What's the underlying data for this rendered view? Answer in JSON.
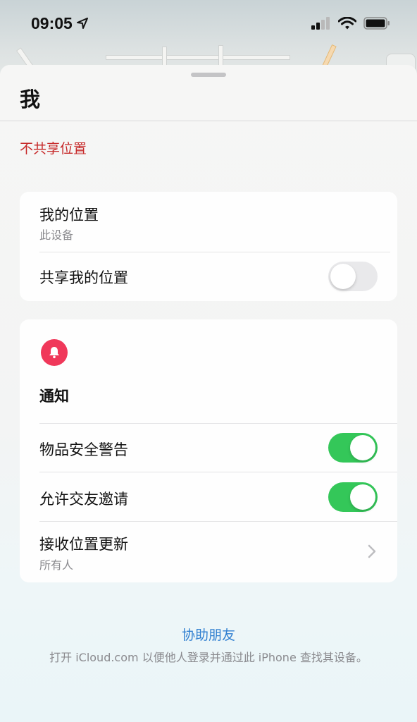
{
  "status_bar": {
    "time": "09:05",
    "location_icon": "location-arrow-icon",
    "signal_icon": "cellular-signal-icon",
    "wifi_icon": "wifi-icon",
    "battery_icon": "battery-icon"
  },
  "sheet": {
    "title": "我",
    "stop_sharing_label": "不共享位置"
  },
  "location_card": {
    "my_location_title": "我的位置",
    "my_location_sub": "此设备",
    "share_my_location_label": "共享我的位置",
    "share_my_location_on": false
  },
  "notifications_card": {
    "icon": "bell-icon",
    "heading": "通知",
    "item_safety_label": "物品安全警告",
    "item_safety_on": true,
    "friend_invites_label": "允许交友邀请",
    "friend_invites_on": true,
    "receive_updates_label": "接收位置更新",
    "receive_updates_value": "所有人"
  },
  "footer": {
    "help_link": "协助朋友",
    "help_text": "打开 iCloud.com 以便他人登录并通过此 iPhone 查找其设备。"
  },
  "colors": {
    "accent_blue": "#2f7fd0",
    "destructive_red": "#c62828",
    "toggle_on": "#34c759",
    "bell_badge": "#f0385a"
  }
}
